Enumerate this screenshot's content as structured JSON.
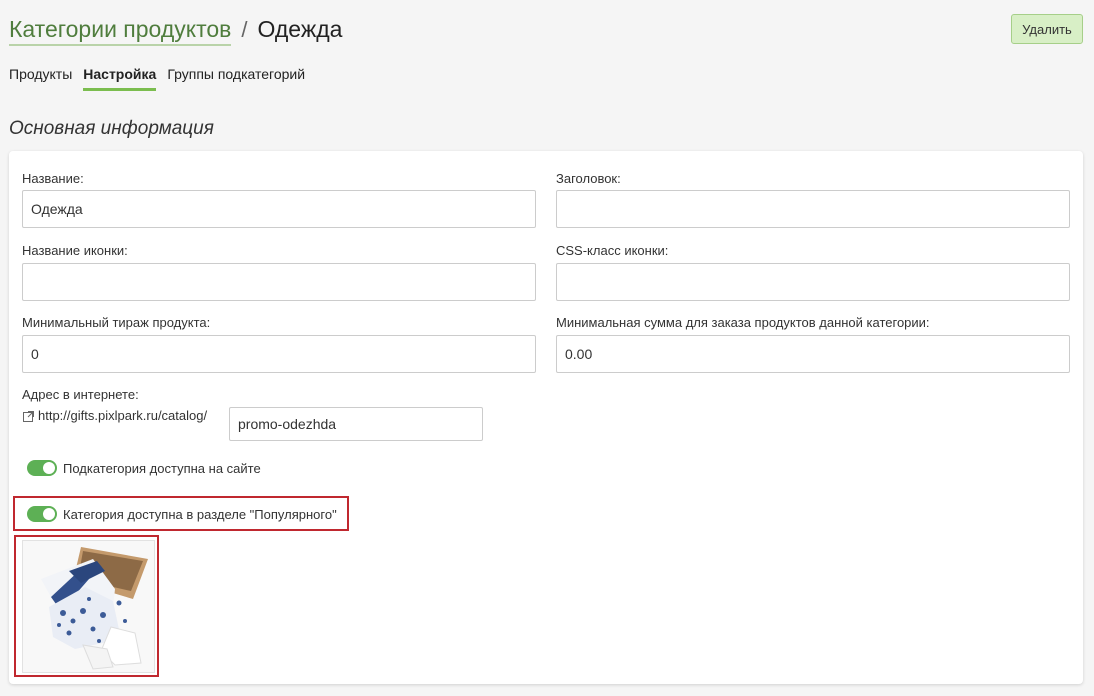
{
  "breadcrumb": {
    "parent": "Категории продуктов",
    "separator": "/",
    "current": "Одежда"
  },
  "actions": {
    "delete_label": "Удалить"
  },
  "tabs": [
    {
      "label": "Продукты",
      "active": false
    },
    {
      "label": "Настройка",
      "active": true
    },
    {
      "label": "Группы подкатегорий",
      "active": false
    }
  ],
  "section": {
    "title": "Основная информация"
  },
  "form": {
    "name": {
      "label": "Название:",
      "value": "Одежда"
    },
    "heading": {
      "label": "Заголовок:",
      "value": ""
    },
    "icon_name": {
      "label": "Название иконки:",
      "value": ""
    },
    "icon_css": {
      "label": "CSS-класс иконки:",
      "value": ""
    },
    "min_run": {
      "label": "Минимальный тираж продукта:",
      "value": "0"
    },
    "min_sum": {
      "label": "Минимальная сумма для заказа продуктов данной категории:",
      "value": "0.00"
    },
    "url": {
      "label": "Адрес в интернете:",
      "prefix": "http://gifts.pixlpark.ru/catalog/",
      "value": "promo-odezhda"
    }
  },
  "toggles": [
    {
      "label": "Подкатегория доступна на сайте",
      "on": true
    },
    {
      "label": "Категория доступна в разделе \"Популярного\"",
      "on": true
    }
  ],
  "colors": {
    "accent": "#7bbd4f",
    "toggle_on": "#5db055",
    "highlight": "#c0282f",
    "link": "#4f7d3d"
  },
  "icons": {
    "external_link": "external-link-icon"
  }
}
